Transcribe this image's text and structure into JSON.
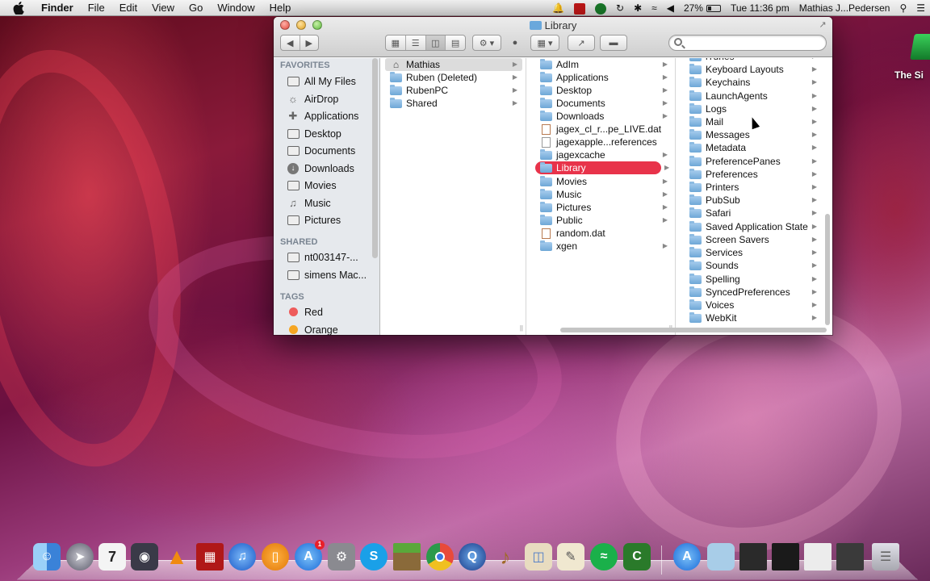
{
  "menubar": {
    "app": "Finder",
    "items": [
      "File",
      "Edit",
      "View",
      "Go",
      "Window",
      "Help"
    ],
    "battery": "27%",
    "clock": "Tue 11:36 pm",
    "user": "Mathias J...Pedersen"
  },
  "desktop": {
    "item_label": "The Si"
  },
  "window": {
    "title": "Library",
    "search_placeholder": ""
  },
  "sidebar": {
    "favorites_header": "FAVORITES",
    "favorites": [
      {
        "label": "All My Files",
        "icon": "all-files-icon"
      },
      {
        "label": "AirDrop",
        "icon": "airdrop-icon"
      },
      {
        "label": "Applications",
        "icon": "applications-icon"
      },
      {
        "label": "Desktop",
        "icon": "desktop-icon"
      },
      {
        "label": "Documents",
        "icon": "documents-icon"
      },
      {
        "label": "Downloads",
        "icon": "downloads-icon"
      },
      {
        "label": "Movies",
        "icon": "movies-icon"
      },
      {
        "label": "Music",
        "icon": "music-icon"
      },
      {
        "label": "Pictures",
        "icon": "pictures-icon"
      }
    ],
    "shared_header": "SHARED",
    "shared": [
      {
        "label": "nt003147-...",
        "icon": "computer-icon"
      },
      {
        "label": "simens Mac...",
        "icon": "computer-icon"
      }
    ],
    "tags_header": "TAGS",
    "tags": [
      {
        "label": "Red",
        "color": "#ee5b5b"
      },
      {
        "label": "Orange",
        "color": "#f6a623"
      }
    ]
  },
  "column1": {
    "items": [
      {
        "label": "Mathias",
        "icon": "home-icon",
        "selected": true
      },
      {
        "label": "Ruben (Deleted)",
        "icon": "folder-icon"
      },
      {
        "label": "RubenPC",
        "icon": "folder-icon"
      },
      {
        "label": "Shared",
        "icon": "folder-icon"
      }
    ]
  },
  "column2": {
    "items": [
      {
        "label": "AdIm",
        "icon": "folder-icon",
        "arrow": true
      },
      {
        "label": "Applications",
        "icon": "folder-icon",
        "arrow": true
      },
      {
        "label": "Desktop",
        "icon": "folder-icon",
        "arrow": true
      },
      {
        "label": "Documents",
        "icon": "folder-icon",
        "arrow": true
      },
      {
        "label": "Downloads",
        "icon": "folder-icon",
        "arrow": true
      },
      {
        "label": "jagex_cl_r...pe_LIVE.dat",
        "icon": "dat-file-icon",
        "arrow": false
      },
      {
        "label": "jagexapple...references",
        "icon": "file-icon",
        "arrow": false
      },
      {
        "label": "jagexcache",
        "icon": "folder-icon",
        "arrow": true
      },
      {
        "label": "Library",
        "icon": "folder-icon",
        "arrow": true,
        "selected": true
      },
      {
        "label": "Movies",
        "icon": "folder-icon",
        "arrow": true
      },
      {
        "label": "Music",
        "icon": "folder-icon",
        "arrow": true
      },
      {
        "label": "Pictures",
        "icon": "folder-icon",
        "arrow": true
      },
      {
        "label": "Public",
        "icon": "folder-icon",
        "arrow": true
      },
      {
        "label": "random.dat",
        "icon": "dat-file-icon",
        "arrow": false
      },
      {
        "label": "xgen",
        "icon": "folder-icon",
        "arrow": true
      }
    ]
  },
  "column3": {
    "items": [
      {
        "label": "iTunes"
      },
      {
        "label": "Keyboard Layouts"
      },
      {
        "label": "Keychains"
      },
      {
        "label": "LaunchAgents"
      },
      {
        "label": "Logs"
      },
      {
        "label": "Mail"
      },
      {
        "label": "Messages"
      },
      {
        "label": "Metadata"
      },
      {
        "label": "PreferencePanes"
      },
      {
        "label": "Preferences"
      },
      {
        "label": "Printers"
      },
      {
        "label": "PubSub"
      },
      {
        "label": "Safari"
      },
      {
        "label": "Saved Application State"
      },
      {
        "label": "Screen Savers"
      },
      {
        "label": "Services"
      },
      {
        "label": "Sounds"
      },
      {
        "label": "Spelling"
      },
      {
        "label": "SyncedPreferences"
      },
      {
        "label": "Voices"
      },
      {
        "label": "WebKit"
      }
    ]
  },
  "dock": {
    "calendar_day": "7",
    "appstore_badge": "1",
    "icons": [
      {
        "name": "finder-icon",
        "color": "#5a9ee8"
      },
      {
        "name": "launchpad-icon",
        "color": "#7a7a8a"
      },
      {
        "name": "calendar-icon",
        "color": "#f2f2f2"
      },
      {
        "name": "facetime-icon",
        "color": "#3a3a4a"
      },
      {
        "name": "vlc-icon",
        "color": "#f08a10"
      },
      {
        "name": "photobooth-icon",
        "color": "#b01818"
      },
      {
        "name": "itunes-icon",
        "color": "#2a7ae0"
      },
      {
        "name": "ibooks-icon",
        "color": "#f08a10"
      },
      {
        "name": "appstore-icon",
        "color": "#2a86e8"
      },
      {
        "name": "system-preferences-icon",
        "color": "#8a8a8a"
      },
      {
        "name": "skype-icon",
        "color": "#1aa0e8"
      },
      {
        "name": "minecraft-icon",
        "color": "#5a8a3a"
      },
      {
        "name": "chrome-icon",
        "color": "#e84a3a"
      },
      {
        "name": "quicktime-icon",
        "color": "#2a5aa8"
      },
      {
        "name": "garageband-icon",
        "color": "#a06a2a"
      },
      {
        "name": "preview-icon",
        "color": "#d8c8a8"
      },
      {
        "name": "textedit-icon",
        "color": "#e8e0c8"
      },
      {
        "name": "spotify-icon",
        "color": "#1a9a3a"
      },
      {
        "name": "camtasia-icon",
        "color": "#2a7a2a"
      },
      {
        "name": "appstore-folder-icon",
        "color": "#2a86e8"
      },
      {
        "name": "documents-stack-icon",
        "color": "#a8cde8"
      },
      {
        "name": "window-thumb-1-icon",
        "color": "#2a2a2a"
      },
      {
        "name": "window-thumb-2-icon",
        "color": "#1a1a1a"
      },
      {
        "name": "window-thumb-3-icon",
        "color": "#e8e8e8"
      },
      {
        "name": "window-thumb-4-icon",
        "color": "#3a3a3a"
      },
      {
        "name": "trash-icon",
        "color": "#b8b8c0"
      }
    ]
  }
}
